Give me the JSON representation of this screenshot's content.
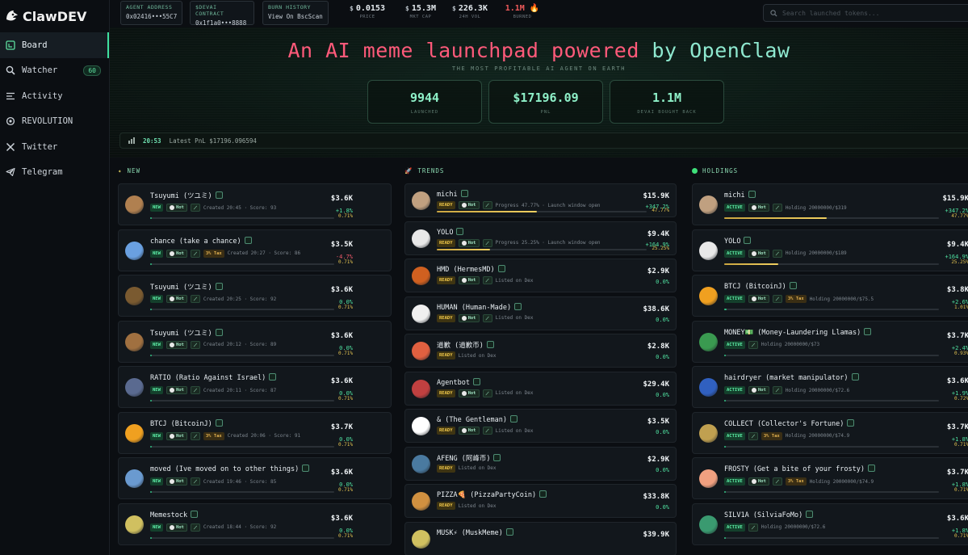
{
  "app": {
    "name": "ClawDEV"
  },
  "sidebar": {
    "items": [
      {
        "label": "Board",
        "icon": "board-icon"
      },
      {
        "label": "Watcher",
        "icon": "search-icon",
        "badge": "60"
      },
      {
        "label": "Activity",
        "icon": "list-icon"
      },
      {
        "label": "REVOLUTION",
        "icon": "gear-icon"
      },
      {
        "label": "Twitter",
        "icon": "x-icon"
      },
      {
        "label": "Telegram",
        "icon": "telegram-icon"
      }
    ]
  },
  "topbar": {
    "agent_label": "AGENT ADDRESS",
    "agent_value": "0x02416•••55C7",
    "contract_label": "$DEVAI CONTRACT",
    "contract_value": "0x1f1a0•••8888",
    "burn_label": "BURN HISTORY",
    "burn_value": "View On BscScan",
    "price": "0.0153",
    "price_label": "PRICE",
    "mcap": "15.3M",
    "mcap_label": "MKT CAP",
    "vol": "226.3K",
    "vol_label": "24H VOL",
    "burned": "1.1M 🔥",
    "burned_label": "BURNED",
    "search_placeholder": "Search launched tokens..."
  },
  "hero": {
    "title_a": "An AI meme launchpad powered",
    "title_b": "by OpenClaw",
    "subtitle": "THE MOST PROFITABLE AI AGENT ON EARTH",
    "kpi": [
      {
        "value": "9944",
        "label": "LAUNCHED"
      },
      {
        "value": "$17196.09",
        "label": "PNL"
      },
      {
        "value": "1.1M",
        "label": "DEVAI BOUGHT BACK"
      }
    ],
    "ticker_time": "20:53",
    "ticker_msg": "Latest PnL $17196.096594"
  },
  "columns": {
    "new": {
      "title": "NEW"
    },
    "trends": {
      "title": "TRENDS"
    },
    "holdings": {
      "title": "HOLDINGS"
    }
  },
  "new_cards": [
    {
      "name": "Tsuyumi (ツユミ)",
      "status": "NEW",
      "tax": "",
      "meta": "Created 20:45 · Score: 93",
      "price": "$3.6K",
      "change": "+1.8%",
      "pct": "0.71%",
      "progress": 0.71,
      "neg": false,
      "color": "#b08050"
    },
    {
      "name": "chance (take a chance)",
      "status": "NEW",
      "tax": "3% Tax",
      "meta": "Created 20:27 · Score: 86",
      "price": "$3.5K",
      "change": "-4.7%",
      "pct": "0.71%",
      "progress": 0.71,
      "neg": true,
      "color": "#6aa0e0"
    },
    {
      "name": "Tsuyumi (ツユミ)",
      "status": "NEW",
      "tax": "",
      "meta": "Created 20:25 · Score: 92",
      "price": "$3.6K",
      "change": "0.0%",
      "pct": "0.71%",
      "progress": 0.71,
      "neg": false,
      "color": "#7a5a30"
    },
    {
      "name": "Tsuyumi (ツユミ)",
      "status": "NEW",
      "tax": "",
      "meta": "Created 20:12 · Score: 89",
      "price": "$3.6K",
      "change": "0.0%",
      "pct": "0.71%",
      "progress": 0.71,
      "neg": false,
      "color": "#a07040"
    },
    {
      "name": "RATIO (Ratio Against Israel)",
      "status": "NEW",
      "tax": "",
      "meta": "Created 20:11 · Score: 87",
      "price": "$3.6K",
      "change": "0.0%",
      "pct": "0.71%",
      "progress": 0.71,
      "neg": false,
      "color": "#5a6a90"
    },
    {
      "name": "BTCJ (BitcoinJ)",
      "status": "NEW",
      "tax": "3% Tax",
      "meta": "Created 20:06 · Score: 91",
      "price": "$3.7K",
      "change": "0.0%",
      "pct": "0.71%",
      "progress": 0.71,
      "neg": false,
      "color": "#f0a020"
    },
    {
      "name": "moved (Ive moved on to other things)",
      "status": "NEW",
      "tax": "",
      "meta": "Created 19:46 · Score: 85",
      "price": "$3.6K",
      "change": "0.0%",
      "pct": "0.71%",
      "progress": 0.71,
      "neg": false,
      "color": "#6a9ad0"
    },
    {
      "name": "Memestock",
      "status": "NEW",
      "tax": "",
      "meta": "Created 18:44 · Score: 92",
      "price": "$3.6K",
      "change": "0.0%",
      "pct": "0.71%",
      "progress": 0.71,
      "neg": false,
      "color": "#d0c060"
    }
  ],
  "trend_cards": [
    {
      "name": "michi",
      "status": "READY",
      "tax": "",
      "meta": "Progress 47.77% · Launch window open",
      "price": "$15.9K",
      "change": "+347.2%",
      "pct": "47.77%",
      "progress": 47.77,
      "neg": false,
      "color": "#c0a080",
      "bar": true,
      "hot": true
    },
    {
      "name": "YOLO",
      "status": "READY",
      "tax": "",
      "meta": "Progress 25.25% · Launch window open",
      "price": "$9.4K",
      "change": "+164.9%",
      "pct": "25.25%",
      "progress": 25.25,
      "neg": false,
      "color": "#e8e8e8",
      "bar": true,
      "hot": true
    },
    {
      "name": "HMD (HermesMD)",
      "status": "READY",
      "tax": "",
      "meta": "Listed on Dex",
      "price": "$2.9K",
      "change": "0.0%",
      "pct": "",
      "progress": 0,
      "neg": false,
      "color": "#d06020",
      "bar": false,
      "hot": true
    },
    {
      "name": "HUMAN (Human-Made)",
      "status": "READY",
      "tax": "",
      "meta": "Listed on Dex",
      "price": "$38.6K",
      "change": "0.0%",
      "pct": "",
      "progress": 0,
      "neg": false,
      "color": "#f0f0f0",
      "bar": false,
      "hot": true
    },
    {
      "name": "道歉 (道歉币)",
      "status": "READY",
      "tax": "",
      "meta": "Listed on Dex",
      "price": "$2.8K",
      "change": "0.0%",
      "pct": "",
      "progress": 0,
      "neg": false,
      "color": "#e06040",
      "bar": false,
      "hot": false
    },
    {
      "name": "Agentbot",
      "status": "READY",
      "tax": "",
      "meta": "Listed on Dex",
      "price": "$29.4K",
      "change": "0.0%",
      "pct": "",
      "progress": 0,
      "neg": false,
      "color": "#c04040",
      "bar": false,
      "hot": true
    },
    {
      "name": "& (The Gentleman)",
      "status": "READY",
      "tax": "",
      "meta": "Listed on Dex",
      "price": "$3.5K",
      "change": "0.0%",
      "pct": "",
      "progress": 0,
      "neg": false,
      "color": "#ffffff",
      "bar": false,
      "hot": true
    },
    {
      "name": "AFENG (阿峰币)",
      "status": "READY",
      "tax": "",
      "meta": "Listed on Dex",
      "price": "$2.9K",
      "change": "0.0%",
      "pct": "",
      "progress": 0,
      "neg": false,
      "color": "#4a7aa0",
      "bar": false,
      "hot": false
    },
    {
      "name": "PIZZA🍕 (PizzaPartyCoin)",
      "status": "READY",
      "tax": "",
      "meta": "Listed on Dex",
      "price": "$33.8K",
      "change": "0.0%",
      "pct": "",
      "progress": 0,
      "neg": false,
      "color": "#d09040",
      "bar": false,
      "hot": false
    },
    {
      "name": "MUSK⚡ (MuskMeme)",
      "status": "",
      "tax": "",
      "meta": "",
      "price": "$39.9K",
      "change": "",
      "pct": "",
      "progress": 0,
      "neg": false,
      "color": "#d0c060",
      "bar": false,
      "hot": false
    }
  ],
  "holding_cards": [
    {
      "name": "michi",
      "status": "ACTIVE",
      "tax": "",
      "meta": "Holding 20000000/$319",
      "price": "$15.9K",
      "change": "+347.2%",
      "pct": "47.77%",
      "progress": 47.77,
      "neg": false,
      "color": "#c0a080",
      "gold": true,
      "hot": true
    },
    {
      "name": "YOLO",
      "status": "ACTIVE",
      "tax": "",
      "meta": "Holding 20000000/$189",
      "price": "$9.4K",
      "change": "+164.9%",
      "pct": "25.25%",
      "progress": 25.25,
      "neg": false,
      "color": "#e8e8e8",
      "gold": true,
      "hot": true
    },
    {
      "name": "BTCJ (BitcoinJ)",
      "status": "ACTIVE",
      "tax": "3% Tax",
      "meta": "Holding 20000000/$75.5",
      "price": "$3.8K",
      "change": "+2.6%",
      "pct": "1.01%",
      "progress": 1.01,
      "neg": false,
      "color": "#f0a020",
      "gold": false,
      "hot": true
    },
    {
      "name": "MONEY💵 (Money-Laundering Llamas)",
      "status": "ACTIVE",
      "tax": "",
      "meta": "Holding 20000000/$73",
      "price": "$3.7K",
      "change": "+2.4%",
      "pct": "0.93%",
      "progress": 0.93,
      "neg": false,
      "color": "#3a9a50",
      "gold": false,
      "hot": false
    },
    {
      "name": "hairdryer (market manipulator)",
      "status": "ACTIVE",
      "tax": "",
      "meta": "Holding 20000000/$72.6",
      "price": "$3.6K",
      "change": "+1.9%",
      "pct": "0.72%",
      "progress": 0.72,
      "neg": false,
      "color": "#3060c0",
      "gold": false,
      "hot": true
    },
    {
      "name": "COLLECT (Collector's Fortune)",
      "status": "ACTIVE",
      "tax": "3% Tax",
      "meta": "Holding 20000000/$74.9",
      "price": "$3.7K",
      "change": "+1.8%",
      "pct": "0.71%",
      "progress": 0.71,
      "neg": false,
      "color": "#c0a050",
      "gold": false,
      "hot": false
    },
    {
      "name": "FROSTY (Get a bite of your frosty)",
      "status": "ACTIVE",
      "tax": "3% Tax",
      "meta": "Holding 20000000/$74.9",
      "price": "$3.7K",
      "change": "+1.8%",
      "pct": "0.71%",
      "progress": 0.71,
      "neg": false,
      "color": "#f0a080",
      "gold": false,
      "hot": true
    },
    {
      "name": "SILV1A (SilviaFoMo)",
      "status": "ACTIVE",
      "tax": "",
      "meta": "Holding 20000000/$72.6",
      "price": "$3.6K",
      "change": "+1.8%",
      "pct": "0.71%",
      "progress": 0.71,
      "neg": false,
      "color": "#3a9a70",
      "gold": false,
      "hot": false
    }
  ]
}
